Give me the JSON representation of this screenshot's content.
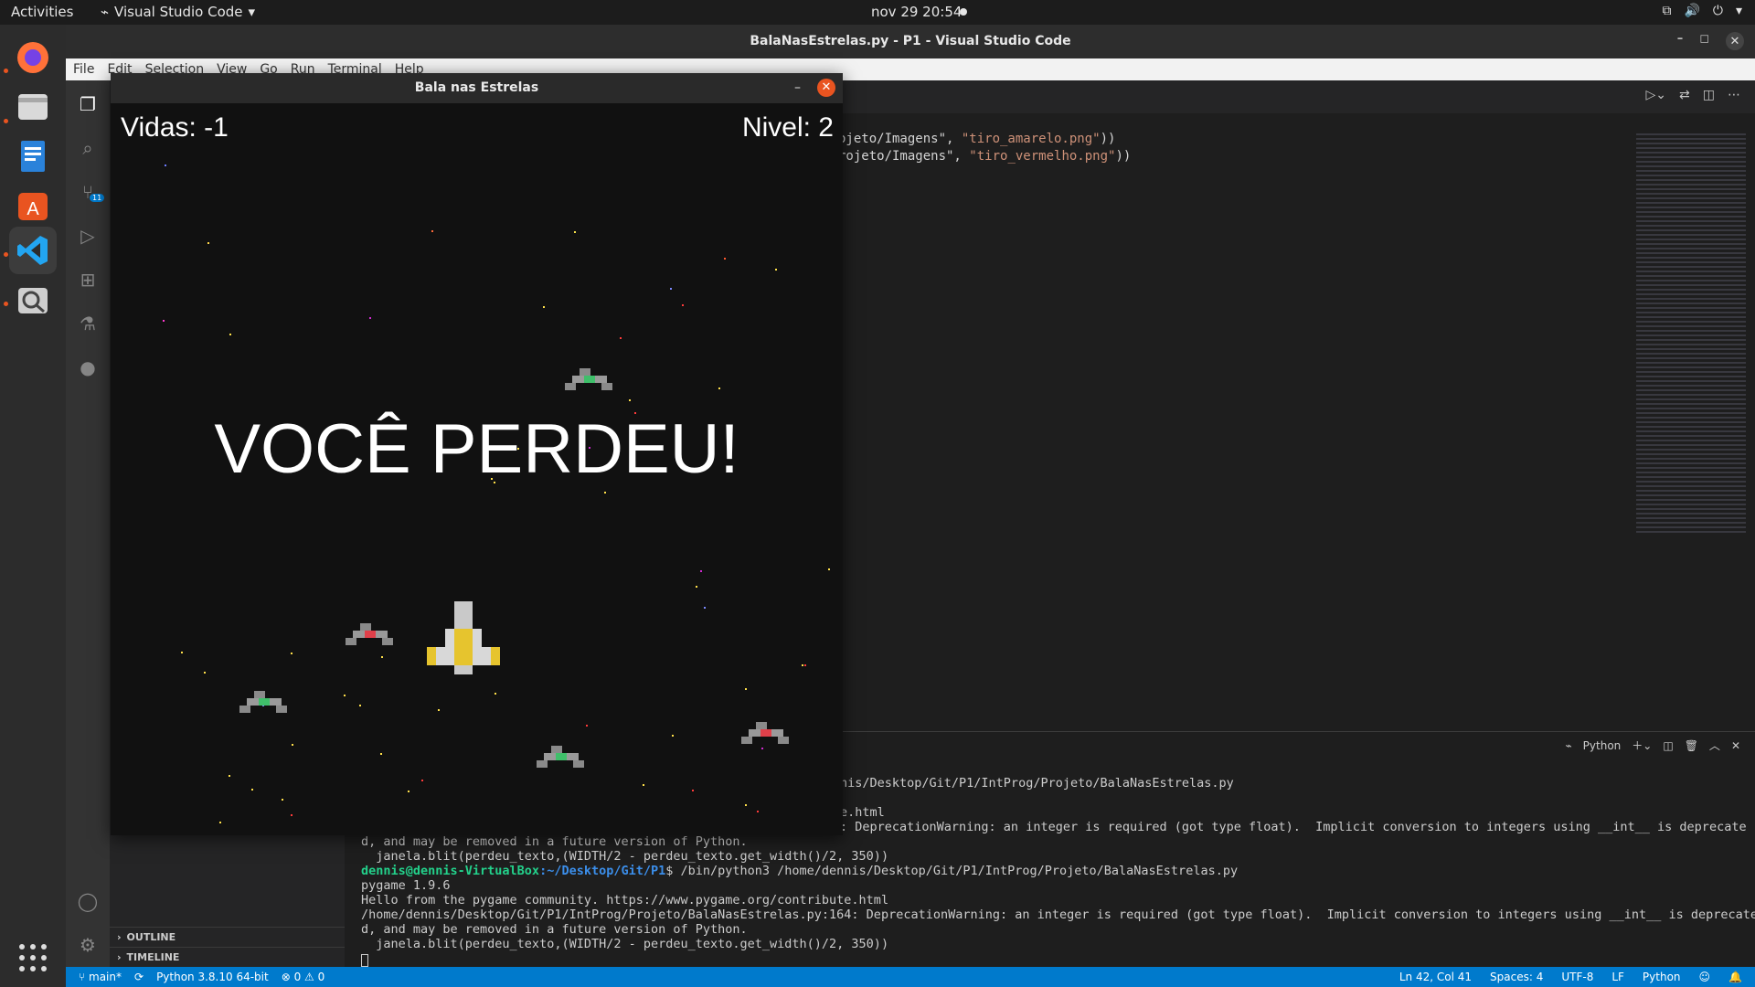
{
  "topbar": {
    "activities": "Activities",
    "app_name": "Visual Studio Code",
    "clock": "nov 29  20:54"
  },
  "dock": {
    "apps": [
      {
        "name": "firefox-icon",
        "color": "#ff7139"
      },
      {
        "name": "files-icon",
        "color": "#d9d9d9"
      },
      {
        "name": "writer-icon",
        "color": "#2a82da"
      },
      {
        "name": "software-icon",
        "color": "#e95420"
      },
      {
        "name": "vscode-icon",
        "color": "#22a5f1"
      },
      {
        "name": "image-viewer-icon",
        "color": "#cfcfcf"
      }
    ]
  },
  "window": {
    "title": "BalaNasEstrelas.py - P1 - Visual Studio Code"
  },
  "menu": [
    "File",
    "Edit",
    "Selection",
    "View",
    "Go",
    "Run",
    "Terminal",
    "Help"
  ],
  "activitybar": {
    "scm_badge": "11"
  },
  "sidebar": {
    "outline": "OUTLINE",
    "timeline": "TIMELINE"
  },
  "editor": {
    "line1_tail": "ojeto/Imagens\", ",
    "line1_str": "\"tiro_amarelo.png\"",
    "line1_end": "))",
    "line2_tail": "rojeto/Imagens\", ",
    "line2_str": "\"tiro_vermelho.png\"",
    "line2_end": "))"
  },
  "panel": {
    "shell_label": "Python",
    "lines": [
      "nis/Desktop/Git/P1/IntProg/Projeto/BalaNasEstrelas.py",
      "e.html",
      ": DeprecationWarning: an integer is required (got type float).  Implicit conversion to integers using __int__ is deprecate",
      "d, and may be removed in a future version of Python.",
      "  janela.blit(perdeu_texto,(WIDTH/2 - perdeu_texto.get_width()/2, 350))"
    ],
    "prompt_user": "dennis@dennis-VirtualBox",
    "prompt_path": ":~/Desktop/Git/P1",
    "prompt_cmd": "$ /bin/python3 /home/dennis/Desktop/Git/P1/IntProg/Projeto/BalaNasEstrelas.py",
    "out": [
      "pygame 1.9.6",
      "Hello from the pygame community. https://www.pygame.org/contribute.html",
      "/home/dennis/Desktop/Git/P1/IntProg/Projeto/BalaNasEstrelas.py:164: DeprecationWarning: an integer is required (got type float).  Implicit conversion to integers using __int__ is deprecate",
      "d, and may be removed in a future version of Python.",
      "  janela.blit(perdeu_texto,(WIDTH/2 - perdeu_texto.get_width()/2, 350))"
    ]
  },
  "status": {
    "branch": "main*",
    "interpreter": "Python 3.8.10 64-bit",
    "problems": "0 ⚠ 0",
    "position": "Ln 42, Col 41",
    "spaces": "Spaces: 4",
    "encoding": "UTF-8",
    "eol": "LF",
    "language": "Python"
  },
  "game": {
    "title": "Bala nas Estrelas",
    "lives": "Vidas: -1",
    "level": "Nivel: 2",
    "lost": "VOCÊ PERDEU!"
  }
}
